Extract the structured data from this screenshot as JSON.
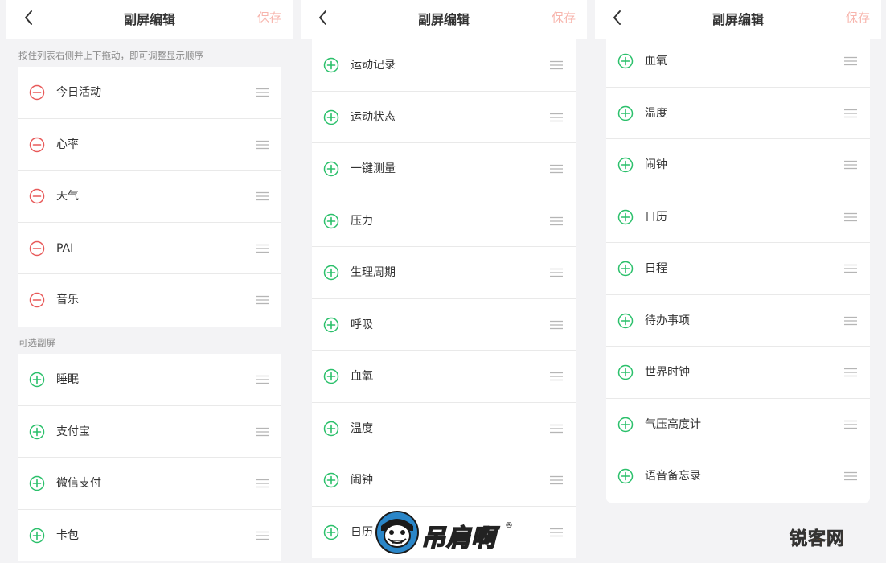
{
  "screens": [
    {
      "title": "副屏编辑",
      "save_label": "保存",
      "hint": "按住列表右侧并上下拖动，即可调整显示顺序",
      "active_items": [
        {
          "label": "今日活动"
        },
        {
          "label": "心率"
        },
        {
          "label": "天气"
        },
        {
          "label": "PAI"
        },
        {
          "label": "音乐"
        }
      ],
      "optional_header": "可选副屏",
      "optional_items": [
        {
          "label": "睡眠"
        },
        {
          "label": "支付宝"
        },
        {
          "label": "微信支付"
        },
        {
          "label": "卡包"
        }
      ]
    },
    {
      "title": "副屏编辑",
      "save_label": "保存",
      "optional_items": [
        {
          "label": "运动记录"
        },
        {
          "label": "运动状态"
        },
        {
          "label": "一键测量"
        },
        {
          "label": "压力"
        },
        {
          "label": "生理周期"
        },
        {
          "label": "呼吸"
        },
        {
          "label": "血氧"
        },
        {
          "label": "温度"
        },
        {
          "label": "闹钟"
        },
        {
          "label": "日历"
        }
      ]
    },
    {
      "title": "副屏编辑",
      "save_label": "保存",
      "optional_items": [
        {
          "label": "血氧"
        },
        {
          "label": "温度"
        },
        {
          "label": "闹钟"
        },
        {
          "label": "日历"
        },
        {
          "label": "日程"
        },
        {
          "label": "待办事项"
        },
        {
          "label": "世界时钟"
        },
        {
          "label": "气压高度计"
        },
        {
          "label": "语音备忘录"
        }
      ]
    }
  ],
  "icons": {
    "back": "chevron-left-icon",
    "remove": "minus-circle-icon",
    "add": "plus-circle-icon",
    "drag": "drag-handle-icon"
  },
  "colors": {
    "remove": "#e85a5a",
    "add": "#2bc06b",
    "save_disabled": "#f7b5ad"
  },
  "watermark": {
    "text": "吊肩啊",
    "mark": "®"
  },
  "corner_mark": "锐客网"
}
